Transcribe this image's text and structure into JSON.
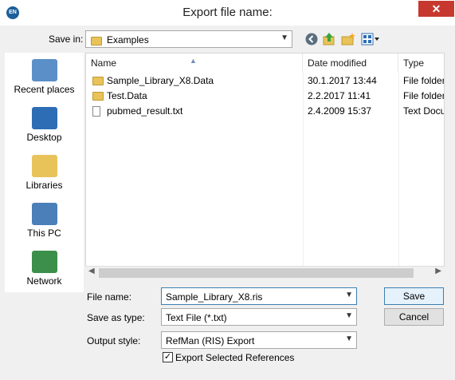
{
  "window": {
    "title": "Export file name:",
    "close_label": "✕",
    "app_icon": "EN"
  },
  "toolbar": {
    "save_in_label": "Save in:",
    "folder": "Examples"
  },
  "places": [
    {
      "label": "Recent places",
      "icon": "recent-places-icon",
      "color": "#5b8fc7"
    },
    {
      "label": "Desktop",
      "icon": "desktop-icon",
      "color": "#2d6db5"
    },
    {
      "label": "Libraries",
      "icon": "libraries-icon",
      "color": "#e8c35a"
    },
    {
      "label": "This PC",
      "icon": "this-pc-icon",
      "color": "#4a7fb8"
    },
    {
      "label": "Network",
      "icon": "network-icon",
      "color": "#3b8f4a"
    }
  ],
  "columns": [
    "Name",
    "Date modified",
    "Type"
  ],
  "files": [
    {
      "name": "Sample_Library_X8.Data",
      "date": "30.1.2017 13:44",
      "type": "File folder",
      "kind": "folder"
    },
    {
      "name": "Test.Data",
      "date": "2.2.2017 11:41",
      "type": "File folder",
      "kind": "folder"
    },
    {
      "name": "pubmed_result.txt",
      "date": "2.4.2009 15:37",
      "type": "Text Docu",
      "kind": "text"
    }
  ],
  "form": {
    "file_name_label": "File name:",
    "file_name_value": "Sample_Library_X8.ris",
    "save_as_type_label": "Save as type:",
    "save_as_type_value": "Text File (*.txt)",
    "output_style_label": "Output style:",
    "output_style_value": "RefMan (RIS) Export",
    "export_selected_label": "Export Selected References",
    "check_mark": "✓"
  },
  "buttons": {
    "save": "Save",
    "cancel": "Cancel"
  }
}
